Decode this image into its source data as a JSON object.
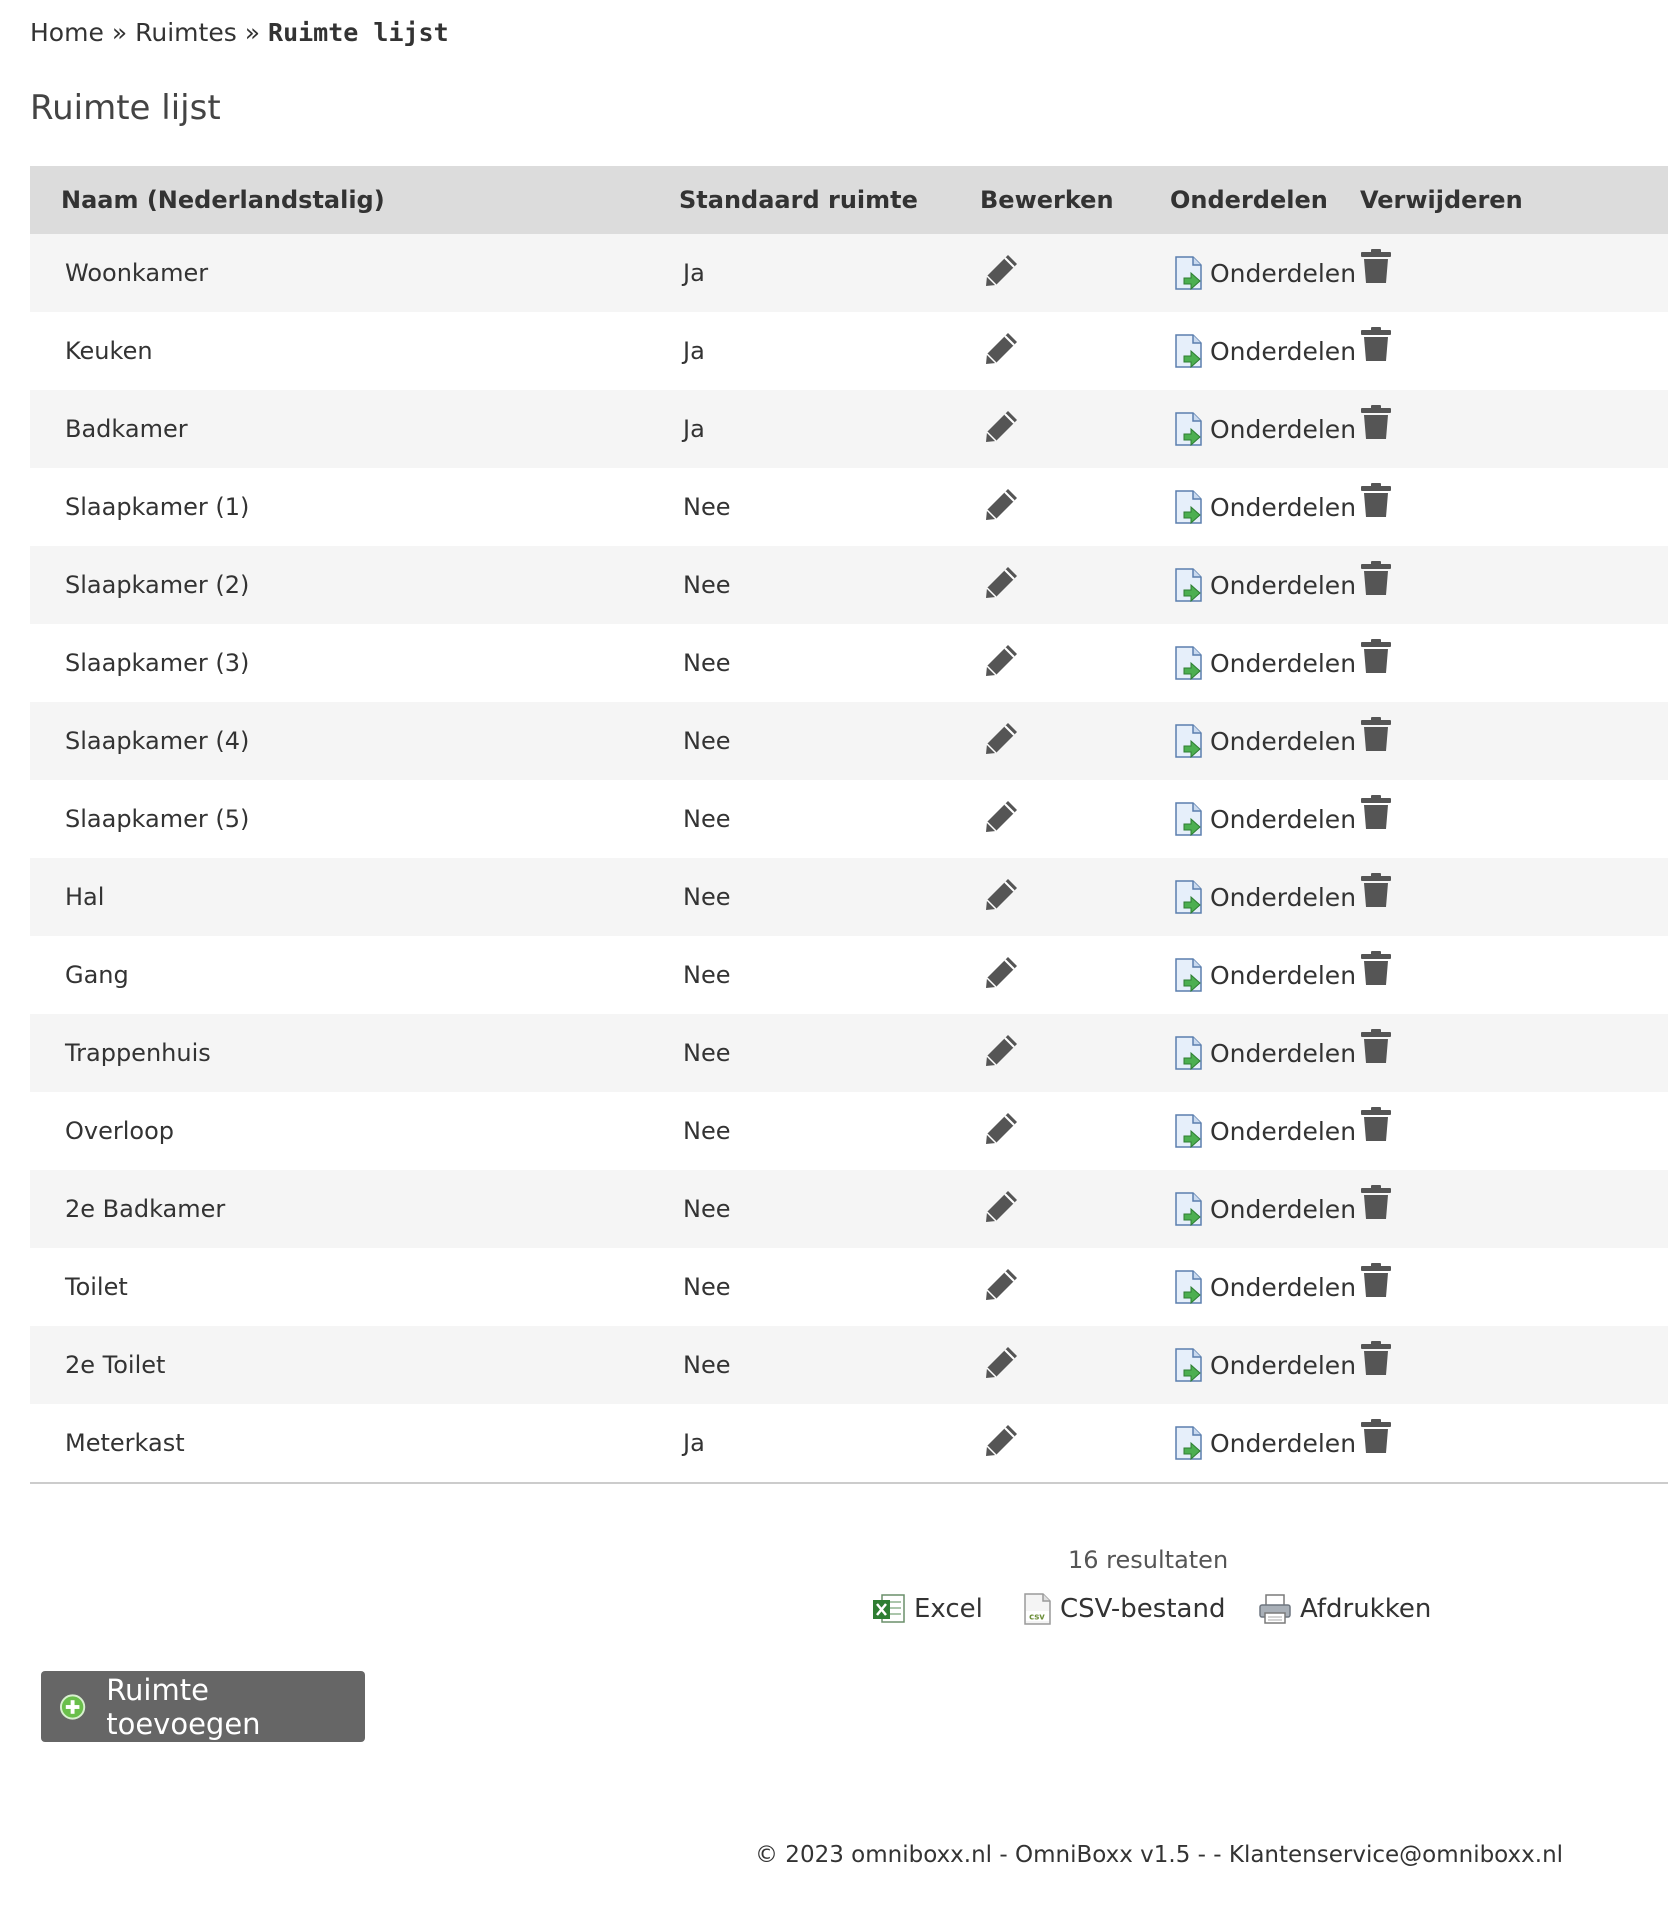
{
  "breadcrumb": {
    "home": "Home",
    "sep1": "»",
    "section": "Ruimtes",
    "sep2": "»",
    "current": "Ruimte lijst"
  },
  "page_title": "Ruimte lijst",
  "table": {
    "headers": {
      "name": "Naam (Nederlandstalig)",
      "standard": "Standaard ruimte",
      "edit": "Bewerken",
      "parts": "Onderdelen",
      "delete": "Verwijderen"
    },
    "parts_label": "Onderdelen",
    "rows": [
      {
        "name": "Woonkamer",
        "standard": "Ja"
      },
      {
        "name": "Keuken",
        "standard": "Ja"
      },
      {
        "name": "Badkamer",
        "standard": "Ja"
      },
      {
        "name": "Slaapkamer (1)",
        "standard": "Nee"
      },
      {
        "name": "Slaapkamer (2)",
        "standard": "Nee"
      },
      {
        "name": "Slaapkamer (3)",
        "standard": "Nee"
      },
      {
        "name": "Slaapkamer (4)",
        "standard": "Nee"
      },
      {
        "name": "Slaapkamer (5)",
        "standard": "Nee"
      },
      {
        "name": "Hal",
        "standard": "Nee"
      },
      {
        "name": "Gang",
        "standard": "Nee"
      },
      {
        "name": "Trappenhuis",
        "standard": "Nee"
      },
      {
        "name": "Overloop",
        "standard": "Nee"
      },
      {
        "name": "2e Badkamer",
        "standard": "Nee"
      },
      {
        "name": "Toilet",
        "standard": "Nee"
      },
      {
        "name": "2e Toilet",
        "standard": "Nee"
      },
      {
        "name": "Meterkast",
        "standard": "Ja"
      }
    ]
  },
  "results_text": "16 resultaten",
  "exports": {
    "excel": "Excel",
    "csv": "CSV-bestand",
    "print": "Afdrukken"
  },
  "add_button": "Ruimte toevoegen",
  "footer": "© 2023 omniboxx.nl - OmniBoxx v1.5 - - Klantenservice@omniboxx.nl",
  "colors": {
    "header_bg": "#dcdcdc",
    "row_alt": "#f5f5f5",
    "button_bg": "#666666",
    "icon": "#555555",
    "arrow_green": "#4caf50"
  }
}
